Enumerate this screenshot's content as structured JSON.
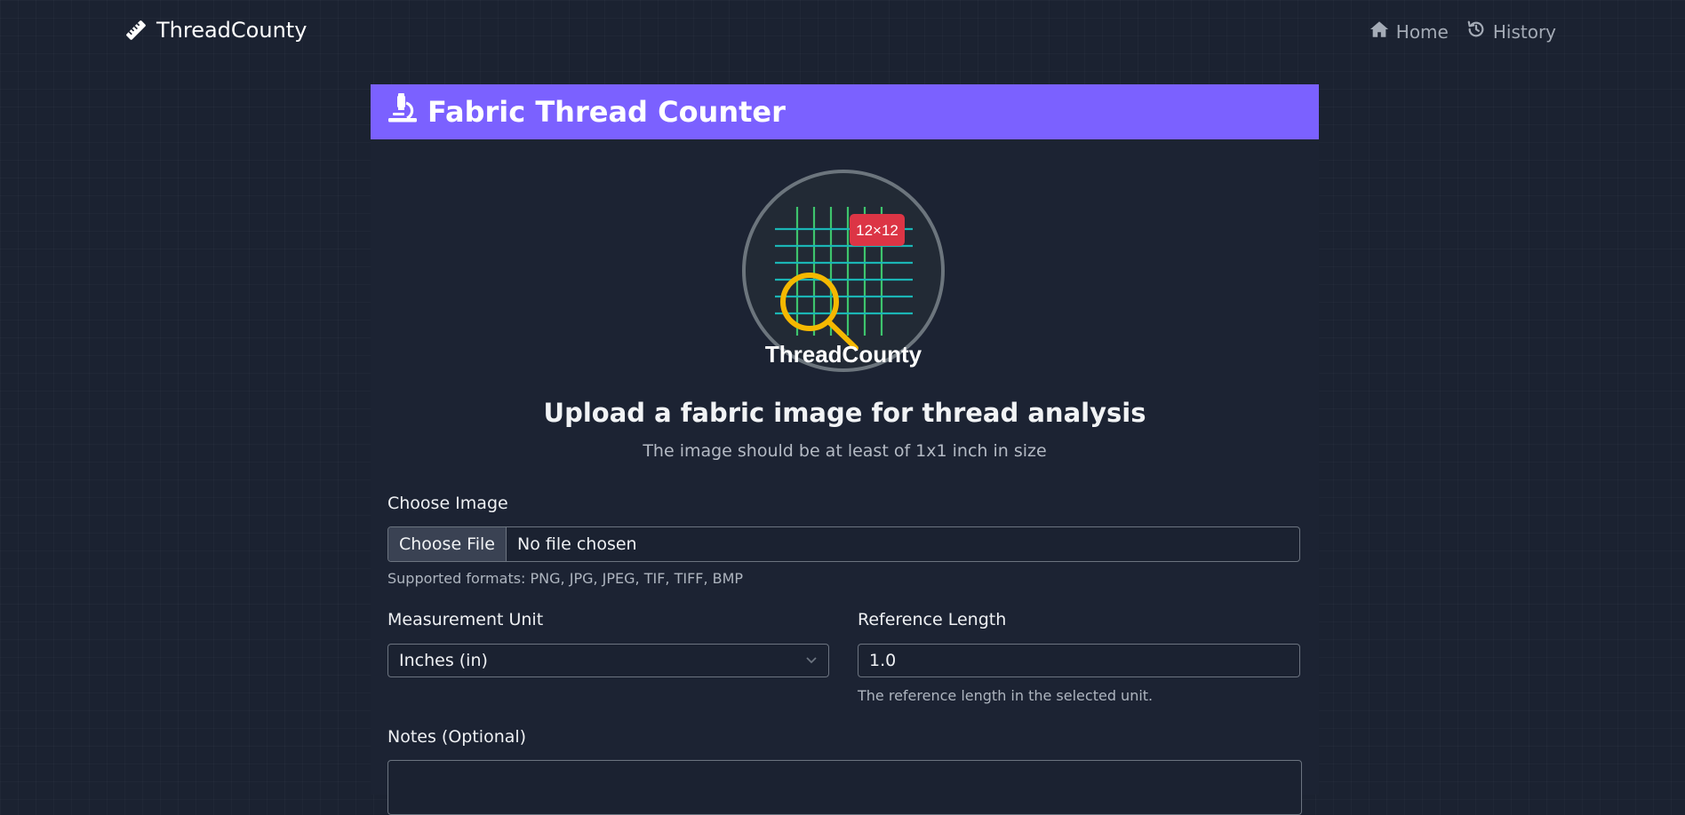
{
  "navbar": {
    "brand": "ThreadCounty",
    "links": [
      {
        "label": "Home",
        "icon": "home-icon"
      },
      {
        "label": "History",
        "icon": "history-icon"
      }
    ]
  },
  "card": {
    "title": "Fabric Thread Counter",
    "title_icon": "microscope-icon"
  },
  "logo": {
    "badge": "12×12",
    "text": "ThreadCounty",
    "colors": {
      "vertical_threads": "#3ec46d",
      "horizontal_threads": "#1bb5b5",
      "magnifier": "#f5b800",
      "badge": "#dc3545",
      "ring": "#6c757d"
    }
  },
  "upload": {
    "heading": "Upload a fabric image for thread analysis",
    "subheading": "The image should be at least of 1x1 inch in size"
  },
  "form": {
    "image_label": "Choose Image",
    "file_button": "Choose File",
    "file_status": "No file chosen",
    "formats_help": "Supported formats: PNG, JPG, JPEG, TIF, TIFF, BMP",
    "unit_label": "Measurement Unit",
    "unit_value": "Inches (in)",
    "ref_label": "Reference Length",
    "ref_value": "1.0",
    "ref_help": "The reference length in the selected unit.",
    "notes_label": "Notes (Optional)"
  },
  "colors": {
    "accent": "#7b61ff",
    "background": "#1b2231"
  }
}
